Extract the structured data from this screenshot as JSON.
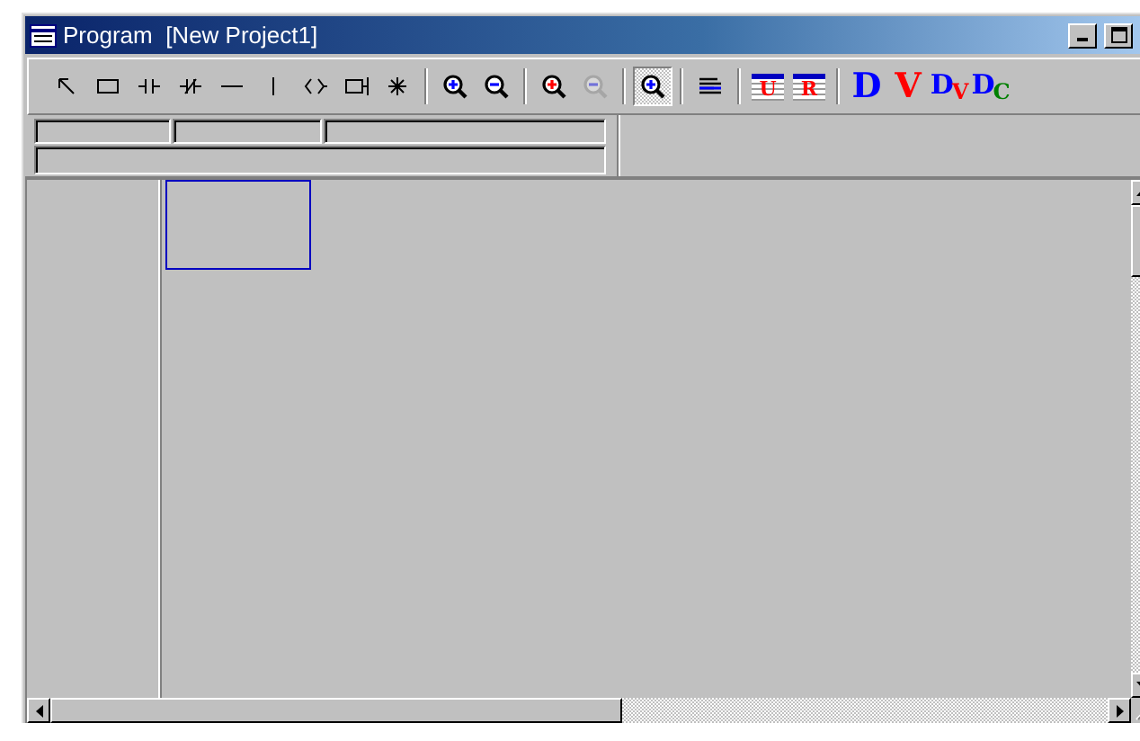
{
  "window": {
    "title": "Program  [New Project1]"
  },
  "toolbar": [
    {
      "kind": "pointer",
      "selected": false,
      "disabled": false
    },
    {
      "kind": "rect",
      "selected": false,
      "disabled": false
    },
    {
      "kind": "contact",
      "selected": false,
      "disabled": false
    },
    {
      "kind": "contact-nc",
      "selected": false,
      "disabled": false
    },
    {
      "kind": "hline",
      "selected": false,
      "disabled": false
    },
    {
      "kind": "vline",
      "selected": false,
      "disabled": false
    },
    {
      "kind": "coil",
      "selected": false,
      "disabled": false
    },
    {
      "kind": "box-out",
      "selected": false,
      "disabled": false
    },
    {
      "kind": "asterisk",
      "selected": false,
      "disabled": false
    },
    {
      "kind": "sep"
    },
    {
      "kind": "zoom-in",
      "selected": false,
      "disabled": false
    },
    {
      "kind": "zoom-out",
      "selected": false,
      "disabled": false
    },
    {
      "kind": "sep"
    },
    {
      "kind": "zoom-in-red",
      "selected": false,
      "disabled": false
    },
    {
      "kind": "zoom-out",
      "selected": false,
      "disabled": true
    },
    {
      "kind": "sep"
    },
    {
      "kind": "zoom-in",
      "selected": true,
      "disabled": false
    },
    {
      "kind": "sep"
    },
    {
      "kind": "lines",
      "selected": false,
      "disabled": false
    },
    {
      "kind": "sep"
    },
    {
      "kind": "table",
      "label": "U",
      "selected": false,
      "disabled": false
    },
    {
      "kind": "table",
      "label": "R",
      "selected": false,
      "disabled": false
    },
    {
      "kind": "sep"
    },
    {
      "kind": "letter",
      "label": "D",
      "color": "#0000ff",
      "selected": false,
      "disabled": false
    },
    {
      "kind": "letter",
      "label": "V",
      "color": "#ff0000",
      "selected": false,
      "disabled": false
    },
    {
      "kind": "letter2",
      "parts": [
        {
          "text": "D",
          "color": "#0000ff"
        },
        {
          "text": "V",
          "color": "#ff0000"
        }
      ],
      "selected": false,
      "disabled": false
    },
    {
      "kind": "letter2",
      "parts": [
        {
          "text": "D",
          "color": "#0000ff"
        },
        {
          "text": "C",
          "color": "#008000"
        }
      ],
      "selected": false,
      "disabled": false
    }
  ]
}
